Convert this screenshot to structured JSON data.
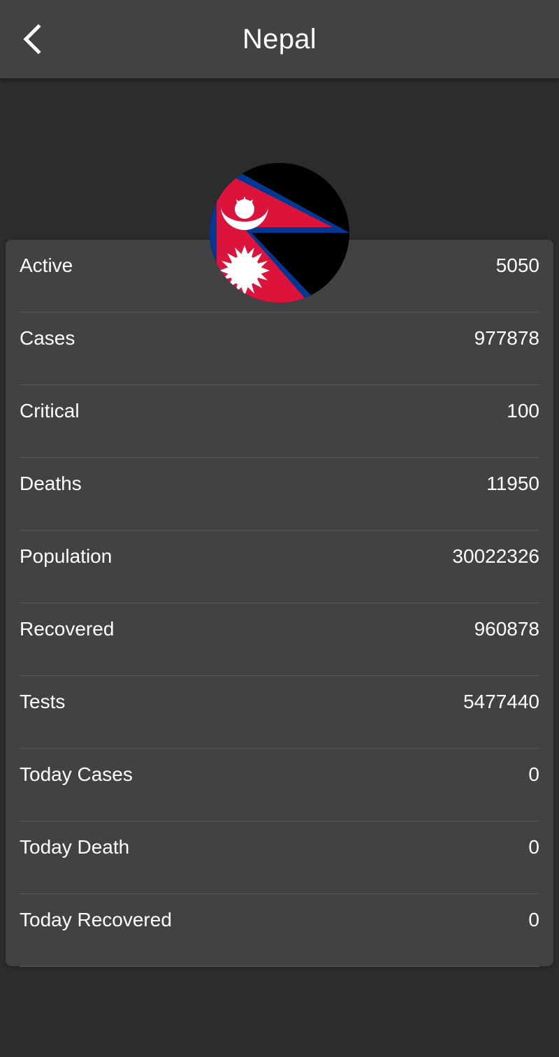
{
  "header": {
    "title": "Nepal",
    "back_icon": "chevron-left-icon"
  },
  "flag": {
    "icon": "nepal-flag-icon",
    "colors": {
      "crimson": "#dc143c",
      "border_blue": "#003893",
      "white": "#ffffff",
      "background": "#000000"
    }
  },
  "stats": [
    {
      "label": "Active",
      "value": "5050"
    },
    {
      "label": "Cases",
      "value": "977878"
    },
    {
      "label": "Critical",
      "value": "100"
    },
    {
      "label": "Deaths",
      "value": "11950"
    },
    {
      "label": "Population",
      "value": "30022326"
    },
    {
      "label": "Recovered",
      "value": "960878"
    },
    {
      "label": "Tests",
      "value": "5477440"
    },
    {
      "label": "Today Cases",
      "value": "0"
    },
    {
      "label": "Today Death",
      "value": "0"
    },
    {
      "label": "Today Recovered",
      "value": "0"
    }
  ],
  "theme": {
    "background": "#2c2c2c",
    "surface": "#424242",
    "divider": "#5a5a5a",
    "text": "#ffffff"
  }
}
